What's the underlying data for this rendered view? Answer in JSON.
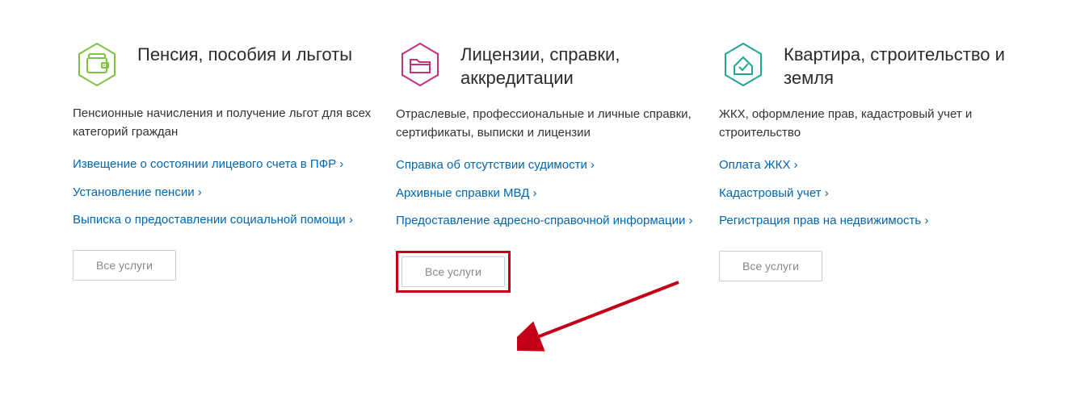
{
  "cards": [
    {
      "title": "Пенсия, пособия и льготы",
      "desc": "Пенсионные начисления и получение льгот для всех категорий граждан",
      "links": [
        "Извещение о состоянии лицевого счета в ПФР",
        "Установление пенсии",
        "Выписка о предоставлении социальной помощи"
      ],
      "button": "Все услуги"
    },
    {
      "title": "Лицензии, справки, аккредитации",
      "desc": "Отраслевые, профессиональные и личные справки, сертификаты, выписки и лицензии",
      "links": [
        "Справка об отсутствии судимости",
        "Архивные справки МВД",
        "Предоставление адресно-справочной информации"
      ],
      "button": "Все услуги"
    },
    {
      "title": "Квартира, строительство и земля",
      "desc": "ЖКХ, оформление прав, кадастровый учет и строительство",
      "links": [
        "Оплата ЖКХ",
        "Кадастровый учет",
        "Регистрация прав на недвижимость"
      ],
      "button": "Все услуги"
    }
  ]
}
